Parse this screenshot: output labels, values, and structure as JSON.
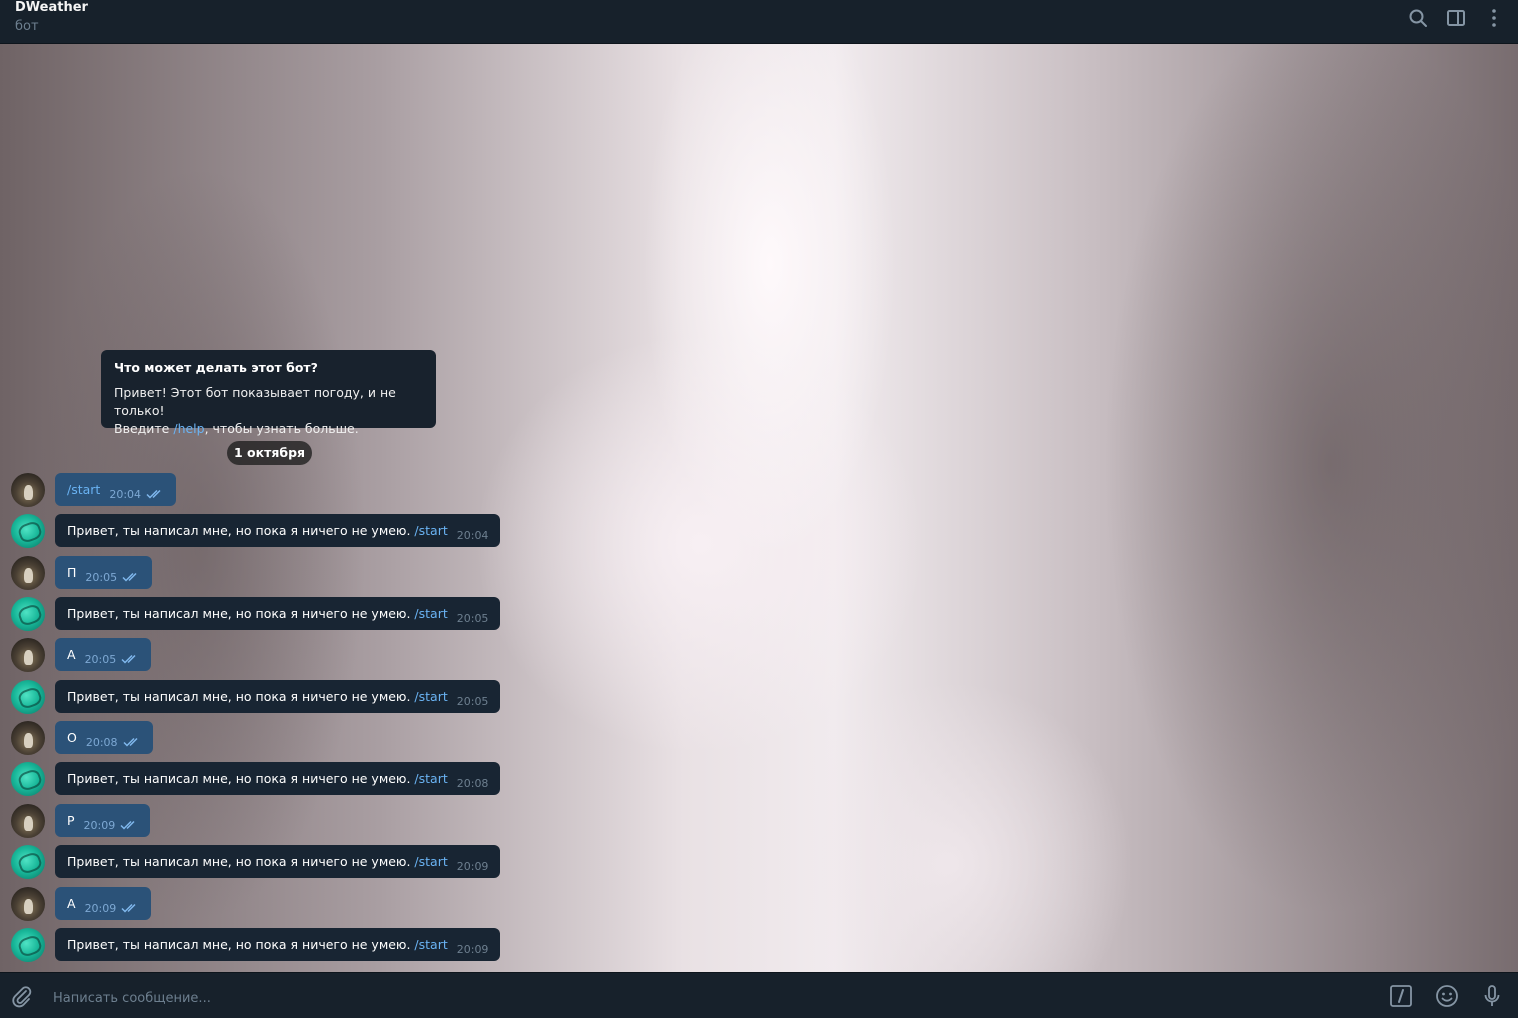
{
  "header": {
    "title": "DWeather",
    "subtitle": "бот",
    "icons": [
      "search-icon",
      "sidebar-toggle-icon",
      "more-vertical-icon"
    ]
  },
  "info_card": {
    "title": "Что может делать этот бот?",
    "line1": "Привет! Этот бот показывает погоду, и не только!",
    "line2_pre": "Введите ",
    "line2_link": "/help",
    "line2_post": ", чтобы узнать больше."
  },
  "date_separator": "1 октября",
  "messages": [
    {
      "from": "user",
      "text": "/start",
      "time": "20:04"
    },
    {
      "from": "bot",
      "text": "Привет, ты написал мне, но пока я ничего не умею. ",
      "link": "/start",
      "time": "20:04"
    },
    {
      "from": "user",
      "text": "П",
      "time": "20:05"
    },
    {
      "from": "bot",
      "text": "Привет, ты написал мне, но пока я ничего не умею. ",
      "link": "/start",
      "time": "20:05"
    },
    {
      "from": "user",
      "text": "А",
      "time": "20:05"
    },
    {
      "from": "bot",
      "text": "Привет, ты написал мне, но пока я ничего не умею. ",
      "link": "/start",
      "time": "20:05"
    },
    {
      "from": "user",
      "text": "О",
      "time": "20:08"
    },
    {
      "from": "bot",
      "text": "Привет, ты написал мне, но пока я ничего не умею. ",
      "link": "/start",
      "time": "20:08"
    },
    {
      "from": "user",
      "text": "Р",
      "time": "20:09"
    },
    {
      "from": "bot",
      "text": "Привет, ты написал мне, но пока я ничего не умею. ",
      "link": "/start",
      "time": "20:09"
    },
    {
      "from": "user",
      "text": "А",
      "time": "20:09"
    },
    {
      "from": "bot",
      "text": "Привет, ты написал мне, но пока я ничего не умею. ",
      "link": "/start",
      "time": "20:09"
    }
  ],
  "composer": {
    "placeholder": "Написать сообщение...",
    "icons": [
      "attach-icon",
      "bot-commands-icon",
      "emoji-icon",
      "microphone-icon"
    ]
  },
  "colors": {
    "header_bg": "#17212b",
    "outgoing_bubble": "#2b5278",
    "incoming_bubble": "#182533",
    "link": "#6ab3f3",
    "muted": "#6d7f8f"
  }
}
